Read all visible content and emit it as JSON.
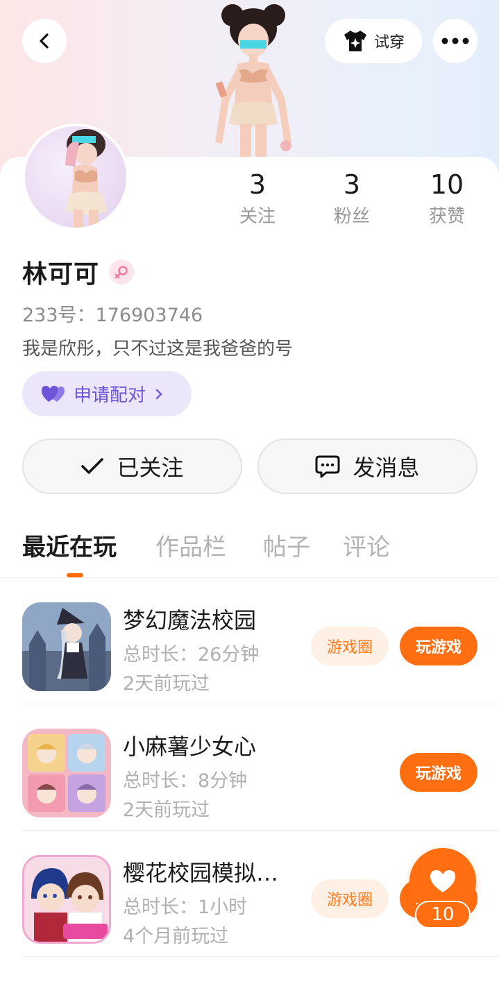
{
  "header": {
    "tryon_label": "试穿"
  },
  "profile": {
    "name": "林可可",
    "id_text": "233号：176903746",
    "bio": "我是欣彤，只不过这是我爸爸的号",
    "pair_label": "申请配对",
    "stats": [
      {
        "value": "3",
        "label": "关注"
      },
      {
        "value": "3",
        "label": "粉丝"
      },
      {
        "value": "10",
        "label": "获赞"
      }
    ]
  },
  "actions": {
    "follow_label": "已关注",
    "message_label": "发消息"
  },
  "tabs": [
    {
      "label": "最近在玩",
      "active": true
    },
    {
      "label": "作品栏",
      "active": false
    },
    {
      "label": "帖子",
      "active": false
    },
    {
      "label": "评论",
      "active": false
    }
  ],
  "games": [
    {
      "title": "梦幻魔法校园",
      "duration": "总时长：26分钟",
      "last_played": "2天前玩过",
      "circle_label": "游戏圈",
      "play_label": "玩游戏"
    },
    {
      "title": "小麻薯少女心",
      "duration": "总时长：8分钟",
      "last_played": "2天前玩过",
      "play_label": "玩游戏"
    },
    {
      "title": "樱花校园模拟…",
      "duration": "总时长：1小时",
      "last_played": "4个月前玩过",
      "circle_label": "游戏圈",
      "play_label": "玩游戏"
    }
  ],
  "like": {
    "count": "10"
  },
  "colors": {
    "accent": "#ff6e10",
    "pair_bg": "#ece6fb",
    "pair_text": "#6e55d8"
  },
  "icons": {
    "back": "chevron-left-icon",
    "tryon": "shirt-sparkle-icon",
    "more": "more-dots-icon",
    "gender": "female-icon",
    "pair": "double-heart-icon",
    "follow": "check-icon",
    "message": "chat-bubble-icon",
    "like": "heart-icon"
  }
}
